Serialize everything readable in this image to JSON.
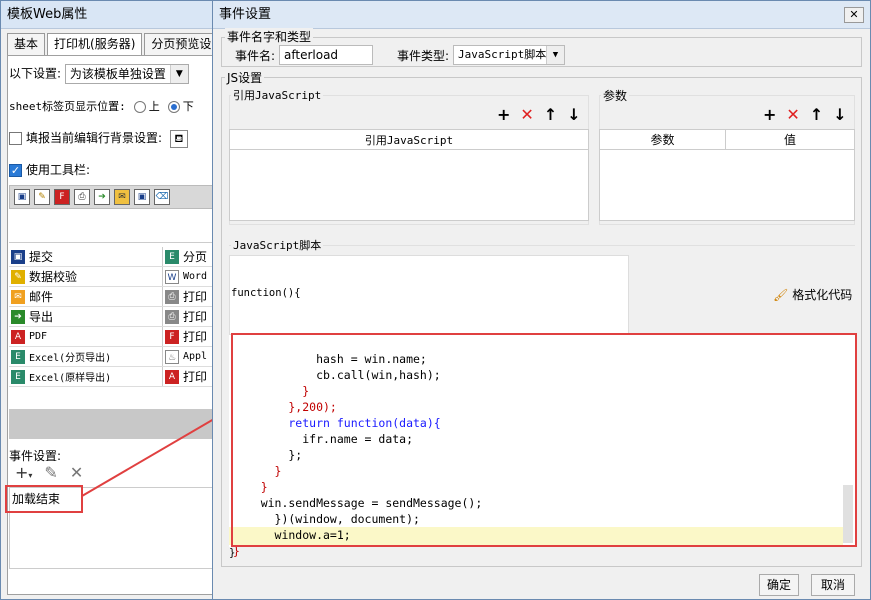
{
  "back_window": {
    "title": "模板Web属性",
    "tabs": [
      "基本",
      "打印机(服务器)",
      "分页预览设"
    ],
    "setting_label": "以下设置:",
    "setting_value": "为该模板单独设置",
    "sheet_pos_label": "sheet标签页显示位置:",
    "radio_top": "上",
    "radio_bottom": "下",
    "fill_bg_label": "填报当前编辑行背景设置:",
    "use_toolbar_label": "使用工具栏:",
    "buttons": [
      {
        "left": "提交",
        "right": "分页"
      },
      {
        "left": "数据校验",
        "right": "Word"
      },
      {
        "left": "邮件",
        "right": "打印"
      },
      {
        "left": "导出",
        "right": "打印"
      },
      {
        "left": "PDF",
        "right": "打印"
      },
      {
        "left": "Excel(分页导出)",
        "right": "Appl"
      },
      {
        "left": "Excel(原样导出)",
        "right": "打印"
      }
    ],
    "event_label": "事件设置:",
    "event_item": "加载结束"
  },
  "dialog": {
    "title": "事件设置",
    "close": "✕",
    "section_name": "事件名字和类型",
    "event_name_label": "事件名:",
    "event_name_value": "afterload",
    "event_type_label": "事件类型:",
    "event_type_value": "JavaScript脚本",
    "js_section": "JS设置",
    "ref_js_label": "引用JavaScript",
    "params_label": "参数",
    "ref_js_col": "引用JavaScript",
    "param_col": "参数",
    "value_col": "值",
    "script_label": "JavaScript脚本",
    "function_start": "function(){",
    "format_code": "格式化代码",
    "code_lines": [
      "            hash = win.name;",
      "            cb.call(win,hash);",
      "          }",
      "        },200);",
      "        return function(data){",
      "          ifr.name = data;",
      "        };",
      "      }",
      "    }",
      "    win.sendMessage = sendMessage();",
      "      })(window, document);",
      "      window.a=1;",
      "}"
    ],
    "closing_brace": "}",
    "ok": "确定",
    "cancel": "取消"
  }
}
